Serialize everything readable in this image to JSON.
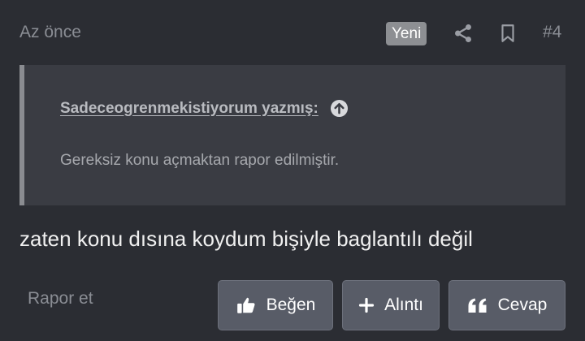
{
  "header": {
    "time": "Az önce",
    "badge": "Yeni",
    "icons": [
      "share-icon",
      "bookmark-icon"
    ],
    "post_number": "#4"
  },
  "quote": {
    "author": "Sadeceogrenmekistiyorum yazmış:",
    "author_icon": "arrow-up-circle-icon",
    "text": "Gereksiz konu açmaktan rapor edilmiştir."
  },
  "message": "zaten konu dısına koydum bişiyle baglantılı değil",
  "footer": {
    "report": "Rapor et",
    "like": "Beğen",
    "quote": "Alıntı",
    "reply": "Cevap"
  },
  "colors": {
    "background": "#2b2d33",
    "quote_background": "#3a3c43",
    "button_background": "#585c67",
    "badge_background": "#8d8f93",
    "muted_text": "#8a8d94"
  }
}
